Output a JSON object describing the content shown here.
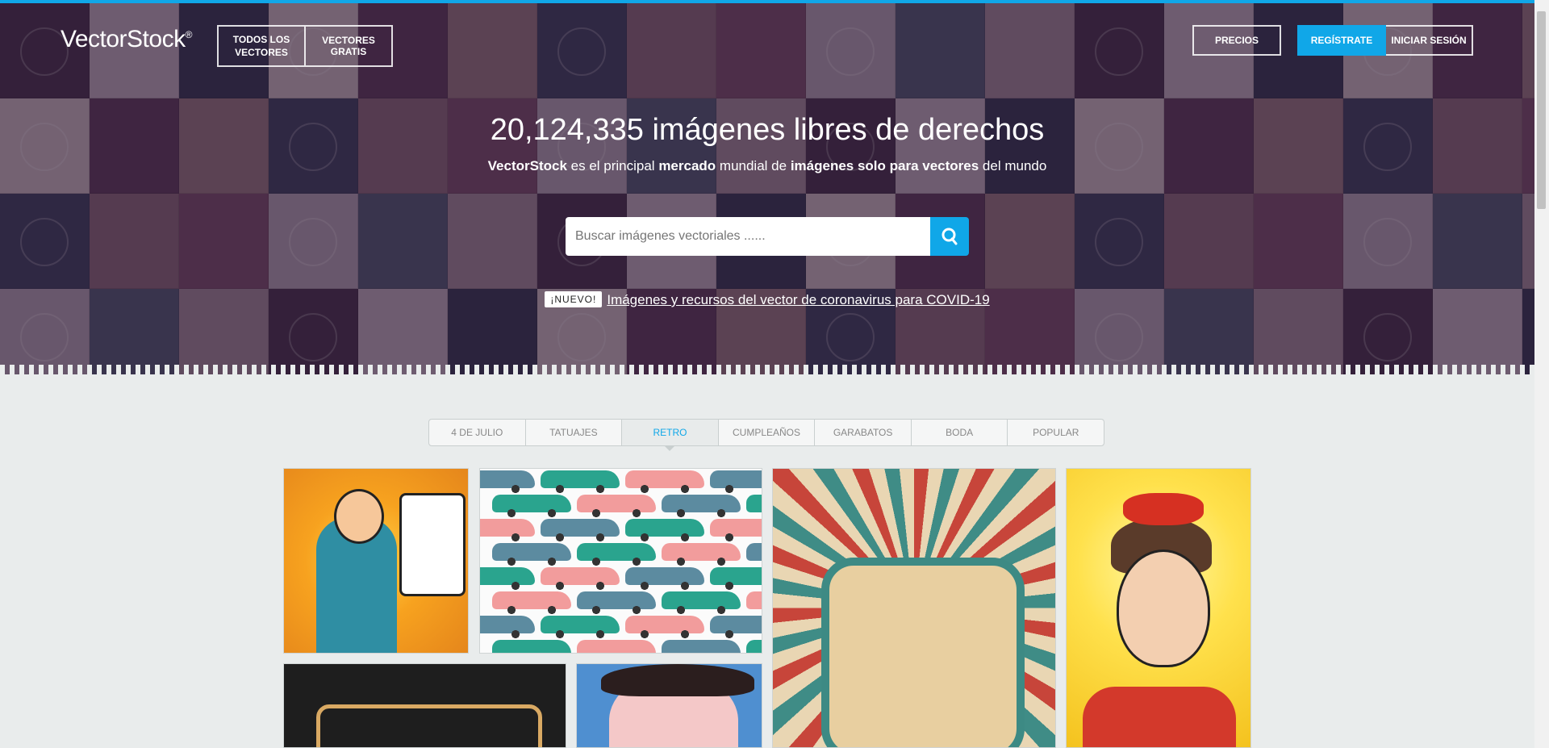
{
  "header": {
    "logo_text": "VectorStock",
    "logo_mark": "®",
    "nav_all_vectors": "TODOS LOS VECTORES",
    "nav_free_vectors": "VECTORES GRATIS",
    "nav_pricing": "PRECIOS",
    "nav_register": "REGÍSTRATE",
    "nav_login": "INICIAR SESIÓN"
  },
  "hero": {
    "headline": "20,124,335 imágenes libres de derechos",
    "sub_brand": "VectorStock",
    "sub_1": " es el principal ",
    "sub_bold_1": "mercado",
    "sub_2": " mundial de ",
    "sub_bold_2": "imágenes solo para vectores",
    "sub_3": " del mundo",
    "search_placeholder": "Buscar imágenes vectoriales ......",
    "new_badge": "¡NUEVO!",
    "covid_link": "Imágenes y recursos del vector de coronavirus para COVID-19"
  },
  "tabs": [
    {
      "label": "4 DE JULIO"
    },
    {
      "label": "TATUAJES"
    },
    {
      "label": "RETRO"
    },
    {
      "label": "CUMPLEAÑOS"
    },
    {
      "label": "GARABATOS"
    },
    {
      "label": "BODA"
    },
    {
      "label": "POPULAR"
    }
  ],
  "active_tab": "RETRO",
  "colors": {
    "accent": "#10a7e8",
    "background": "#e9ecec"
  }
}
